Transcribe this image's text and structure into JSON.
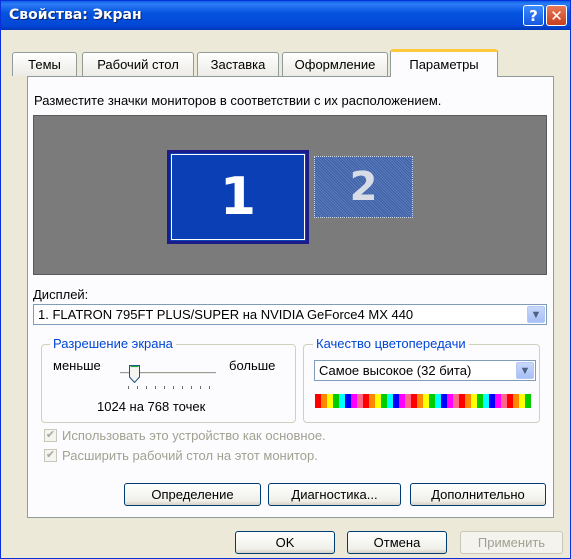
{
  "window": {
    "title": "Свойства: Экран"
  },
  "titlebar": {
    "help_glyph": "?",
    "close_glyph": "✕"
  },
  "tabs": [
    "Темы",
    "Рабочий стол",
    "Заставка",
    "Оформление",
    "Параметры"
  ],
  "active_tab": "Параметры",
  "instructions": "Разместите значки мониторов в соответствии с их расположением.",
  "monitors": [
    "1",
    "2"
  ],
  "display": {
    "label": "Дисплей:",
    "value": "1. FLATRON 795FT PLUS/SUPER на NVIDIA GeForce4 MX 440"
  },
  "resolution": {
    "legend": "Разрешение экрана",
    "less": "меньше",
    "more": "больше",
    "value_text": "1024 на 768 точек",
    "slider_position": 0.1
  },
  "color_quality": {
    "legend": "Качество цветопередачи",
    "value": "Самое высокое (32 бита)"
  },
  "checkboxes": [
    {
      "label": "Использовать это устройство как основное.",
      "checked": true,
      "enabled": false
    },
    {
      "label": "Расширить рабочий стол на этот монитор.",
      "checked": true,
      "enabled": false
    }
  ],
  "panel_buttons": {
    "identify": "Определение",
    "troubleshoot": "Диагностика...",
    "advanced": "Дополнительно"
  },
  "dialog_buttons": {
    "ok": "OK",
    "cancel": "Отмена",
    "apply": "Применить"
  },
  "colors": {
    "titlebar": "#0554E0",
    "monitor_active": "#0A3FB5",
    "monitor_inactive": "#3A5FA8",
    "group_legend": "#0046D5",
    "dialog_bg": "#ECE9D8"
  },
  "icons": {
    "help": "help-icon",
    "close": "close-icon",
    "dropdown": "chevron-down-icon",
    "check": "checkmark-icon"
  }
}
